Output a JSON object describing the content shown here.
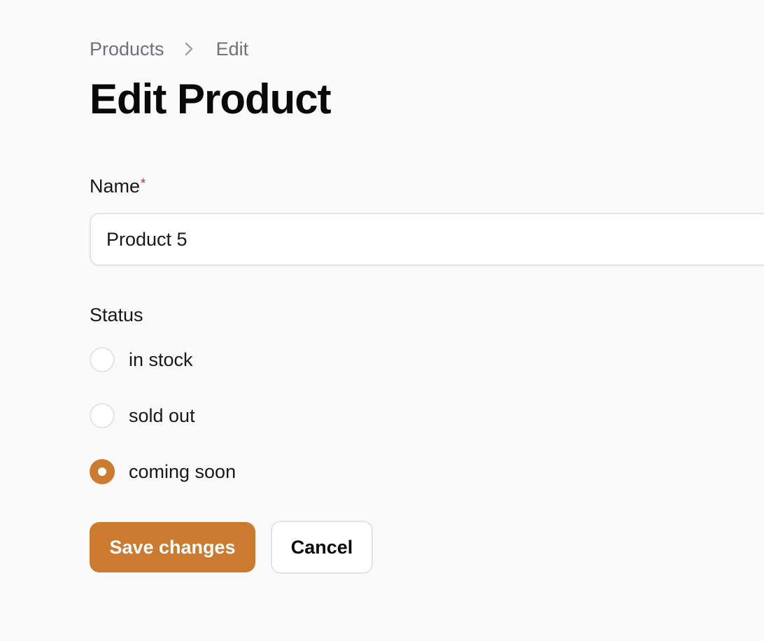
{
  "breadcrumb": {
    "items": [
      "Products",
      "Edit"
    ]
  },
  "page": {
    "title": "Edit Product"
  },
  "form": {
    "name": {
      "label": "Name",
      "required_marker": "*",
      "value": "Product 5"
    },
    "status": {
      "label": "Status",
      "options": [
        "in stock",
        "sold out",
        "coming soon"
      ],
      "selected": "coming soon"
    }
  },
  "actions": {
    "save_label": "Save changes",
    "cancel_label": "Cancel"
  },
  "colors": {
    "accent": "#cc7a30",
    "required": "#dc2626",
    "background": "#fafafa"
  },
  "icons": {
    "breadcrumb_separator": "chevron-right-icon"
  }
}
